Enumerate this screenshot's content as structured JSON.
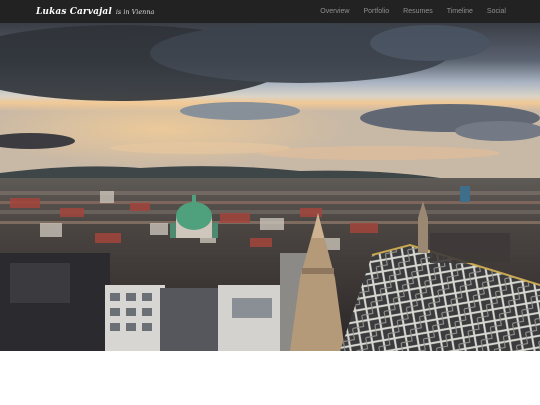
{
  "navbar": {
    "brand_name": "Lukas Carvajal",
    "brand_sub": "is in Vienna",
    "links": [
      "Overview",
      "Portfolio",
      "Resumes",
      "Timeline",
      "Social"
    ],
    "background": "#222222"
  },
  "hero": {
    "image": "Vienna city skyline at dusk viewed from St. Stephen's Cathedral",
    "colors": {
      "sky_dark": "#3b3f47",
      "sky_light": "#c9d3de",
      "sunset": "#f3c48e",
      "dome": "#4fa07d"
    }
  }
}
